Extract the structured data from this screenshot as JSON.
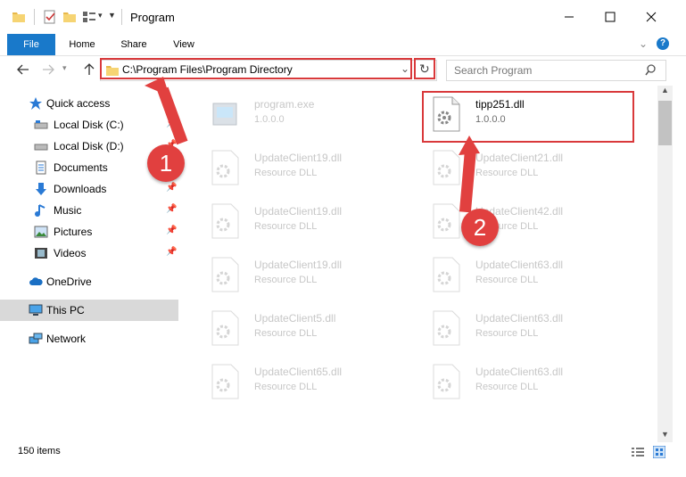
{
  "window": {
    "title": "Program",
    "minimize_icon": "minimize-icon",
    "maximize_icon": "maximize-icon",
    "close_icon": "close-icon"
  },
  "ribbon": {
    "tabs": [
      {
        "label": "File"
      },
      {
        "label": "Home"
      },
      {
        "label": "Share"
      },
      {
        "label": "View"
      }
    ]
  },
  "address": {
    "path": "C:\\Program Files\\Program Directory"
  },
  "search": {
    "placeholder": "Search Program"
  },
  "sidebar": {
    "items": [
      {
        "label": "Quick access",
        "icon": "star-icon"
      },
      {
        "label": "Local Disk (C:)",
        "icon": "drive-icon"
      },
      {
        "label": "Local Disk (D:)",
        "icon": "drive-icon"
      },
      {
        "label": "Documents",
        "icon": "documents-icon"
      },
      {
        "label": "Downloads",
        "icon": "download-icon"
      },
      {
        "label": "Music",
        "icon": "music-icon"
      },
      {
        "label": "Pictures",
        "icon": "pictures-icon"
      },
      {
        "label": "Videos",
        "icon": "videos-icon"
      },
      {
        "label": "OneDrive",
        "icon": "cloud-icon"
      },
      {
        "label": "This PC",
        "icon": "computer-icon"
      },
      {
        "label": "Network",
        "icon": "network-icon"
      }
    ]
  },
  "files": [
    {
      "name": "program.exe",
      "desc": "1.0.0.0"
    },
    {
      "name": "tipp251.dll",
      "desc": "1.0.0.0"
    },
    {
      "name": "UpdateClient19.dll",
      "desc": "Resource DLL"
    },
    {
      "name": "UpdateClient21.dll",
      "desc": "Resource DLL"
    },
    {
      "name": "UpdateClient19.dll",
      "desc": "Resource DLL"
    },
    {
      "name": "UpdateClient42.dll",
      "desc": "Resource DLL"
    },
    {
      "name": "UpdateClient19.dll",
      "desc": "Resource DLL"
    },
    {
      "name": "UpdateClient63.dll",
      "desc": "Resource DLL"
    },
    {
      "name": "UpdateClient5.dll",
      "desc": "Resource DLL"
    },
    {
      "name": "UpdateClient63.dll",
      "desc": "Resource DLL"
    },
    {
      "name": "UpdateClient65.dll",
      "desc": "Resource DLL"
    },
    {
      "name": "UpdateClient63.dll",
      "desc": "Resource DLL"
    }
  ],
  "status": {
    "item_count": "150 items"
  },
  "annotations": {
    "marker1": "1",
    "marker2": "2"
  },
  "colors": {
    "accent": "#1979ca",
    "highlight": "#d9393b",
    "marker": "#e1403f"
  }
}
